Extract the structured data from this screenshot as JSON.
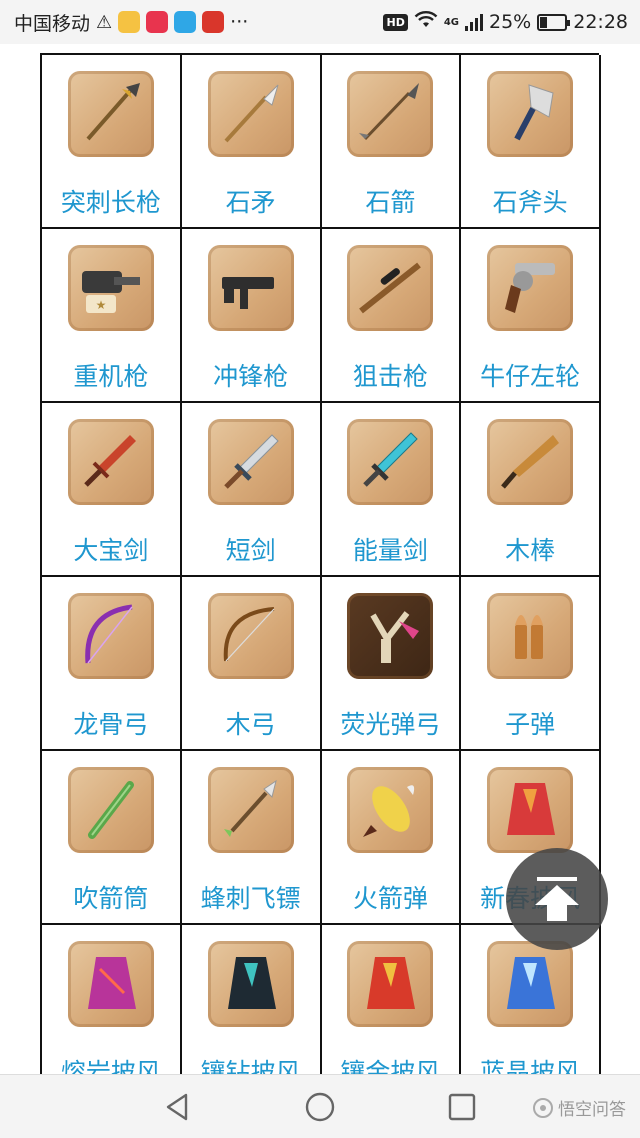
{
  "status_bar": {
    "carrier": "中国移动",
    "network": "4G",
    "battery": "25%",
    "time": "22:28",
    "hd": "HD",
    "more": "···"
  },
  "items": [
    {
      "label": "突刺长枪",
      "icon": "spear-icon"
    },
    {
      "label": "石矛",
      "icon": "stone-spear-icon"
    },
    {
      "label": "石箭",
      "icon": "stone-arrow-icon"
    },
    {
      "label": "石斧头",
      "icon": "stone-axe-icon"
    },
    {
      "label": "重机枪",
      "icon": "heavy-machine-gun-icon"
    },
    {
      "label": "冲锋枪",
      "icon": "submachine-gun-icon"
    },
    {
      "label": "狙击枪",
      "icon": "sniper-rifle-icon"
    },
    {
      "label": "牛仔左轮",
      "icon": "revolver-icon"
    },
    {
      "label": "大宝剑",
      "icon": "great-sword-icon"
    },
    {
      "label": "短剑",
      "icon": "short-sword-icon"
    },
    {
      "label": "能量剑",
      "icon": "energy-sword-icon"
    },
    {
      "label": "木棒",
      "icon": "wooden-club-icon"
    },
    {
      "label": "龙骨弓",
      "icon": "dragon-bow-icon"
    },
    {
      "label": "木弓",
      "icon": "wooden-bow-icon"
    },
    {
      "label": "荧光弹弓",
      "icon": "slingshot-icon"
    },
    {
      "label": "子弹",
      "icon": "bullets-icon"
    },
    {
      "label": "吹箭筒",
      "icon": "blowgun-icon"
    },
    {
      "label": "蜂刺飞镖",
      "icon": "dart-icon"
    },
    {
      "label": "火箭弹",
      "icon": "rocket-icon"
    },
    {
      "label": "新春披风",
      "icon": "red-cape-icon"
    },
    {
      "label": "熔岩披风",
      "icon": "lava-cape-icon"
    },
    {
      "label": "镶钻披风",
      "icon": "diamond-cape-icon"
    },
    {
      "label": "镶金披风",
      "icon": "gold-cape-icon"
    },
    {
      "label": "蓝晶披风",
      "icon": "blue-crystal-cape-icon"
    }
  ],
  "nav_bar": {
    "watermark": "悟空问答"
  }
}
